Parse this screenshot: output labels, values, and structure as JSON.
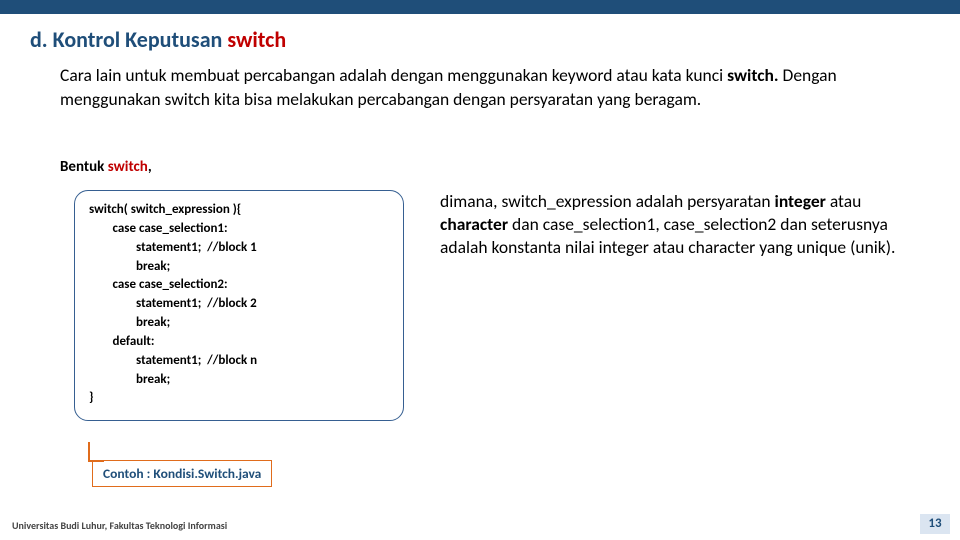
{
  "heading": {
    "marker": "d.",
    "title_prefix": "Kontrol Keputusan ",
    "title_keyword": "switch"
  },
  "intro": {
    "line1": "Cara lain untuk membuat percabangan adalah dengan menggunakan keyword atau kata kunci",
    "kw": "switch.",
    "line2_rest": " Dengan menggunakan switch kita bisa melakukan percabangan dengan persyaratan yang beragam."
  },
  "bentuk": {
    "label": "Bentuk ",
    "kw": "switch",
    "comma": ","
  },
  "code": {
    "l01": "switch( switch_expression ){",
    "l02": "        case case_selection1:",
    "l03": "                statement1;  //block 1",
    "l04": "                break;",
    "l05": "        case case_selection2:",
    "l06": "                statement1;  //block 2",
    "l07": "                break;",
    "l08": "        default:",
    "l09": "                statement1;  //block n",
    "l10": "                break;",
    "l11": "}"
  },
  "desc": {
    "t1": "dimana, switch_expression adalah persyaratan ",
    "b1": "integer",
    "t2": " atau ",
    "b2": "character",
    "t3": " dan case_selection1, case_selection2 dan seterusnya adalah konstanta nilai integer atau character yang unique (unik)."
  },
  "example": {
    "label": "Contoh : Kondisi.Switch.java"
  },
  "footer": {
    "left": "Universitas Budi Luhur, Fakultas Teknologi Informasi",
    "page": "13"
  }
}
